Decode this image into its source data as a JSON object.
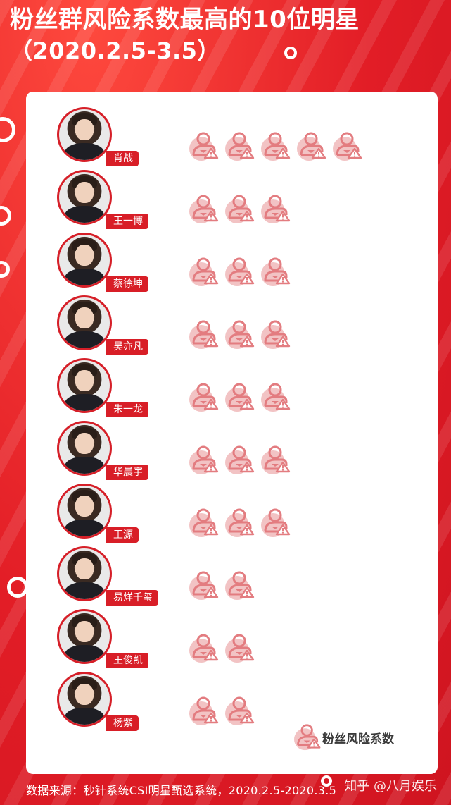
{
  "title": {
    "line1": "粉丝群风险系数最高的10位明星",
    "line2": "（2020.2.5-3.5）"
  },
  "chart_data": {
    "type": "pictograph",
    "series_name": "粉丝风险系数",
    "categories": [
      "肖战",
      "王一博",
      "蔡徐坤",
      "吴亦凡",
      "朱一龙",
      "华晨宇",
      "王源",
      "易烊千玺",
      "王俊凯",
      "杨紫"
    ],
    "values": [
      5,
      3,
      3,
      3,
      3,
      3,
      3,
      2,
      2,
      2
    ]
  },
  "legend": {
    "label": "粉丝风险系数",
    "icon": "fan-risk-icon"
  },
  "source": "数据来源：秒针系统CSI明星甄选系统，2020.2.5-2020.3.5",
  "watermark": "知乎 @八月娱乐",
  "colors": {
    "background": "#e8232b",
    "accent": "#d81e27",
    "icon": "#e37c80",
    "icon_light": "#f2c3c4",
    "card": "#ffffff"
  }
}
